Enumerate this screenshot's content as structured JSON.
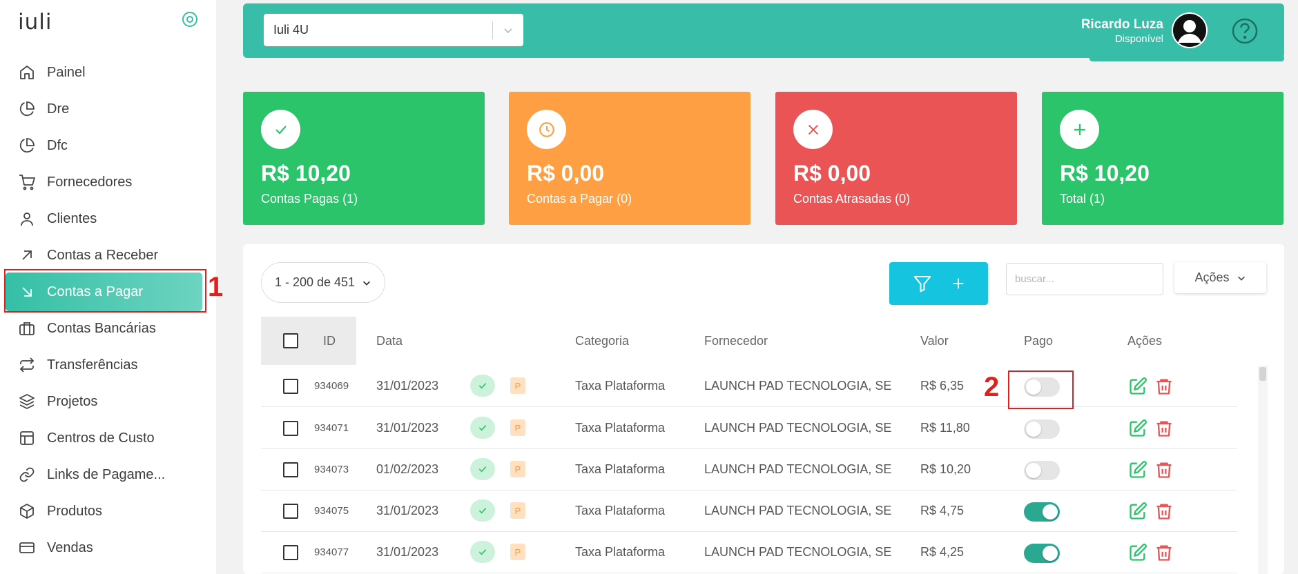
{
  "brand": {
    "logo": "iuli"
  },
  "sidebar": {
    "items": [
      {
        "label": "Painel",
        "icon": "home-icon"
      },
      {
        "label": "Dre",
        "icon": "pie-chart-icon"
      },
      {
        "label": "Dfc",
        "icon": "pie-chart-icon"
      },
      {
        "label": "Fornecedores",
        "icon": "cart-icon"
      },
      {
        "label": "Clientes",
        "icon": "user-icon"
      },
      {
        "label": "Contas a Receber",
        "icon": "arrow-up-right-icon"
      },
      {
        "label": "Contas a Pagar",
        "icon": "arrow-down-right-icon",
        "active": true
      },
      {
        "label": "Contas Bancárias",
        "icon": "briefcase-icon"
      },
      {
        "label": "Transferências",
        "icon": "repeat-icon"
      },
      {
        "label": "Projetos",
        "icon": "layers-icon"
      },
      {
        "label": "Centros de Custo",
        "icon": "layout-icon"
      },
      {
        "label": "Links de Pagame...",
        "icon": "link-icon"
      },
      {
        "label": "Produtos",
        "icon": "box-icon"
      },
      {
        "label": "Vendas",
        "icon": "credit-card-icon"
      }
    ]
  },
  "annotations": {
    "one": "1",
    "two": "2"
  },
  "topbar": {
    "company": "Iuli 4U",
    "user_name": "Ricardo Luza",
    "user_status": "Disponível"
  },
  "cards": [
    {
      "amount": "R$ 10,20",
      "label": "Contas Pagas (1)",
      "color": "#2bc46a",
      "icon": "check-icon"
    },
    {
      "amount": "R$ 0,00",
      "label": "Contas a Pagar (0)",
      "color": "#fe9f43",
      "icon": "clock-icon"
    },
    {
      "amount": "R$ 0,00",
      "label": "Contas Atrasadas (0)",
      "color": "#ea5455",
      "icon": "x-icon"
    },
    {
      "amount": "R$ 10,20",
      "label": "Total (1)",
      "color": "#2bc46a",
      "icon": "plus-icon"
    }
  ],
  "toolbar": {
    "pagination": "1 - 200 de 451",
    "search_placeholder": "buscar...",
    "actions_label": "Ações"
  },
  "table": {
    "headers": {
      "id": "ID",
      "date": "Data",
      "category": "Categoria",
      "supplier": "Fornecedor",
      "value": "Valor",
      "paid": "Pago",
      "actions": "Ações"
    },
    "rows": [
      {
        "id": "934069",
        "date": "31/01/2023",
        "badge": "P",
        "category": "Taxa Plataforma",
        "supplier": "LAUNCH PAD TECNOLOGIA, SE",
        "value": "R$ 6,35",
        "paid": false
      },
      {
        "id": "934071",
        "date": "31/01/2023",
        "badge": "P",
        "category": "Taxa Plataforma",
        "supplier": "LAUNCH PAD TECNOLOGIA, SE",
        "value": "R$ 11,80",
        "paid": false
      },
      {
        "id": "934073",
        "date": "01/02/2023",
        "badge": "P",
        "category": "Taxa Plataforma",
        "supplier": "LAUNCH PAD TECNOLOGIA, SE",
        "value": "R$ 10,20",
        "paid": false
      },
      {
        "id": "934075",
        "date": "31/01/2023",
        "badge": "P",
        "category": "Taxa Plataforma",
        "supplier": "LAUNCH PAD TECNOLOGIA, SE",
        "value": "R$ 4,75",
        "paid": true
      },
      {
        "id": "934077",
        "date": "31/01/2023",
        "badge": "P",
        "category": "Taxa Plataforma",
        "supplier": "LAUNCH PAD TECNOLOGIA, SE",
        "value": "R$ 4,25",
        "paid": true
      }
    ]
  }
}
